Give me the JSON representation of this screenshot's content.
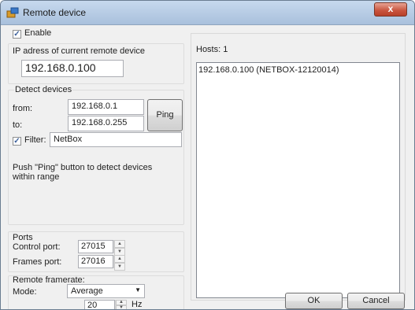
{
  "window": {
    "title": "Remote device",
    "close_glyph": "x",
    "icon": "remote-device-app-icon"
  },
  "enable": {
    "label": "Enable",
    "checked": true
  },
  "ip_section": {
    "label": "IP adress of current remote device",
    "value": "192.168.0.100"
  },
  "detect": {
    "title": "Detect devices",
    "from_label": "from:",
    "from_value": "192.168.0.1",
    "to_label": "to:",
    "to_value": "192.168.0.255",
    "ping_label": "Ping",
    "filter_label": "Filter:",
    "filter_checked": true,
    "filter_value": "NetBox",
    "hint": "Push \"Ping\" button to detect devices within range"
  },
  "ports": {
    "title": "Ports",
    "control_label": "Control port:",
    "control_value": "27015",
    "frames_label": "Frames port:",
    "frames_value": "27016"
  },
  "framerate": {
    "title": "Remote framerate:",
    "mode_label": "Mode:",
    "mode_value": "Average",
    "hz_value": "20",
    "hz_unit": "Hz"
  },
  "hosts": {
    "label": "Hosts: 1",
    "items": [
      "192.168.0.100 (NETBOX-12120014)"
    ]
  },
  "footer": {
    "ok_label": "OK",
    "cancel_label": "Cancel"
  },
  "colors": {
    "titlebar": "#b6cbe4",
    "close_button": "#c8533c",
    "checkmark": "#3b5f9a"
  }
}
